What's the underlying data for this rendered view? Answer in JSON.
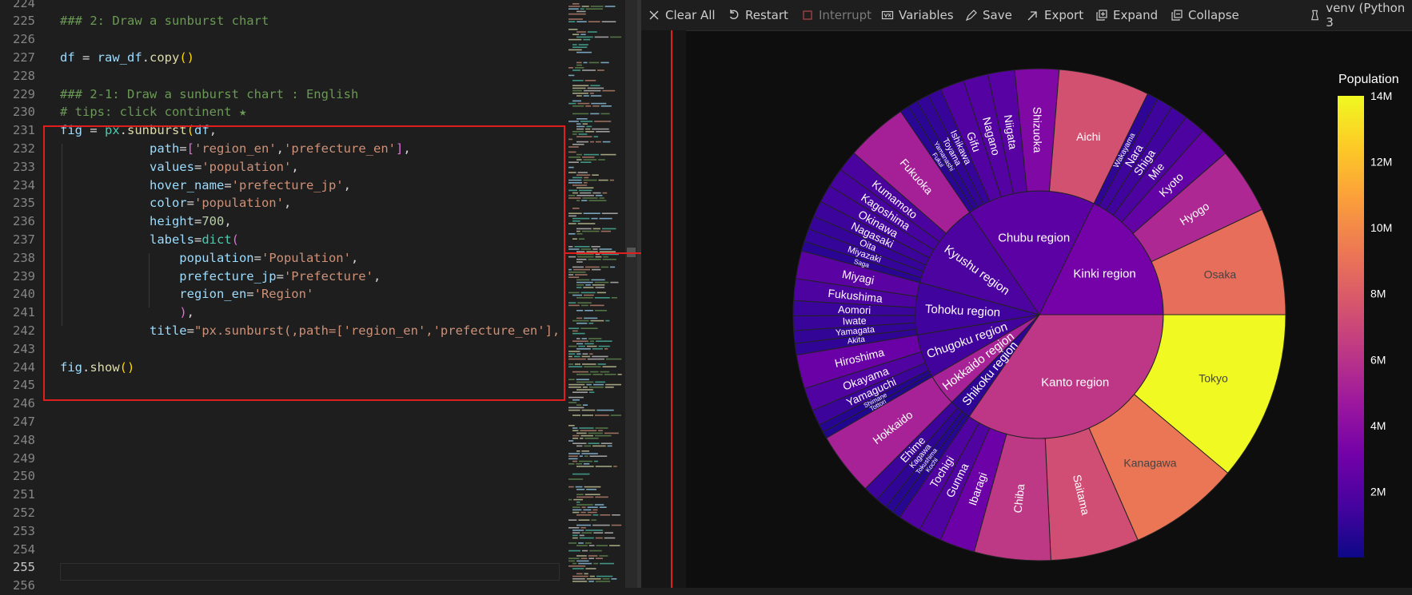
{
  "editor": {
    "current_line": 255,
    "lines": [
      {
        "n": 224,
        "tokens": []
      },
      {
        "n": 225,
        "tokens": [
          {
            "t": "### 2: Draw a sunburst chart",
            "c": "com"
          }
        ]
      },
      {
        "n": 226,
        "tokens": []
      },
      {
        "n": 227,
        "tokens": [
          {
            "t": "df",
            "c": "var"
          },
          {
            "t": " = ",
            "c": "op"
          },
          {
            "t": "raw_df",
            "c": "var"
          },
          {
            "t": ".",
            "c": "op"
          },
          {
            "t": "copy",
            "c": "fn"
          },
          {
            "t": "()",
            "c": "br"
          }
        ]
      },
      {
        "n": 228,
        "tokens": []
      },
      {
        "n": 229,
        "tokens": [
          {
            "t": "### 2-1: Draw a sunburst chart : English",
            "c": "com"
          }
        ]
      },
      {
        "n": 230,
        "tokens": [
          {
            "t": "# tips: click continent ★",
            "c": "com"
          }
        ]
      },
      {
        "n": 231,
        "tokens": [
          {
            "t": "fig",
            "c": "var"
          },
          {
            "t": " = ",
            "c": "op"
          },
          {
            "t": "px",
            "c": "cls"
          },
          {
            "t": ".",
            "c": "op"
          },
          {
            "t": "sunburst",
            "c": "fn"
          },
          {
            "t": "(",
            "c": "br"
          },
          {
            "t": "df",
            "c": "var"
          },
          {
            "t": ",",
            "c": "op"
          }
        ]
      },
      {
        "n": 232,
        "tokens": [
          {
            "t": "            path",
            "c": "var"
          },
          {
            "t": "=",
            "c": "op"
          },
          {
            "t": "[",
            "c": "br2"
          },
          {
            "t": "'region_en'",
            "c": "str"
          },
          {
            "t": ",",
            "c": "op"
          },
          {
            "t": "'prefecture_en'",
            "c": "str"
          },
          {
            "t": "]",
            "c": "br2"
          },
          {
            "t": ",",
            "c": "op"
          }
        ]
      },
      {
        "n": 233,
        "tokens": [
          {
            "t": "            values",
            "c": "var"
          },
          {
            "t": "=",
            "c": "op"
          },
          {
            "t": "'population'",
            "c": "str"
          },
          {
            "t": ",",
            "c": "op"
          }
        ]
      },
      {
        "n": 234,
        "tokens": [
          {
            "t": "            hover_name",
            "c": "var"
          },
          {
            "t": "=",
            "c": "op"
          },
          {
            "t": "'prefecture_jp'",
            "c": "str"
          },
          {
            "t": ",",
            "c": "op"
          }
        ]
      },
      {
        "n": 235,
        "tokens": [
          {
            "t": "            color",
            "c": "var"
          },
          {
            "t": "=",
            "c": "op"
          },
          {
            "t": "'population'",
            "c": "str"
          },
          {
            "t": ",",
            "c": "op"
          }
        ]
      },
      {
        "n": 236,
        "tokens": [
          {
            "t": "            height",
            "c": "var"
          },
          {
            "t": "=",
            "c": "op"
          },
          {
            "t": "700",
            "c": "num"
          },
          {
            "t": ",",
            "c": "op"
          }
        ]
      },
      {
        "n": 237,
        "tokens": [
          {
            "t": "            labels",
            "c": "var"
          },
          {
            "t": "=",
            "c": "op"
          },
          {
            "t": "dict",
            "c": "cls"
          },
          {
            "t": "(",
            "c": "br2"
          }
        ]
      },
      {
        "n": 238,
        "tokens": [
          {
            "t": "                population",
            "c": "var"
          },
          {
            "t": "=",
            "c": "op"
          },
          {
            "t": "'Population'",
            "c": "str"
          },
          {
            "t": ",",
            "c": "op"
          }
        ]
      },
      {
        "n": 239,
        "tokens": [
          {
            "t": "                prefecture_jp",
            "c": "var"
          },
          {
            "t": "=",
            "c": "op"
          },
          {
            "t": "'Prefecture'",
            "c": "str"
          },
          {
            "t": ",",
            "c": "op"
          }
        ]
      },
      {
        "n": 240,
        "tokens": [
          {
            "t": "                region_en",
            "c": "var"
          },
          {
            "t": "=",
            "c": "op"
          },
          {
            "t": "'Region'",
            "c": "str"
          }
        ]
      },
      {
        "n": 241,
        "tokens": [
          {
            "t": "                ",
            "c": "op"
          },
          {
            "t": ")",
            "c": "br2"
          },
          {
            "t": ",",
            "c": "op"
          }
        ]
      },
      {
        "n": 242,
        "tokens": [
          {
            "t": "            title",
            "c": "var"
          },
          {
            "t": "=",
            "c": "op"
          },
          {
            "t": "\"px.sunburst(,path=['region_en','prefecture_en'],",
            "c": "str"
          }
        ]
      },
      {
        "n": 243,
        "tokens": []
      },
      {
        "n": 244,
        "tokens": [
          {
            "t": "fig",
            "c": "var"
          },
          {
            "t": ".",
            "c": "op"
          },
          {
            "t": "show",
            "c": "fn"
          },
          {
            "t": "()",
            "c": "br"
          }
        ]
      },
      {
        "n": 245,
        "tokens": []
      },
      {
        "n": 246,
        "tokens": []
      },
      {
        "n": 247,
        "tokens": []
      },
      {
        "n": 248,
        "tokens": []
      },
      {
        "n": 249,
        "tokens": []
      },
      {
        "n": 250,
        "tokens": []
      },
      {
        "n": 251,
        "tokens": []
      },
      {
        "n": 252,
        "tokens": []
      },
      {
        "n": 253,
        "tokens": []
      },
      {
        "n": 254,
        "tokens": []
      },
      {
        "n": 255,
        "tokens": []
      },
      {
        "n": 256,
        "tokens": []
      }
    ]
  },
  "toolbar": {
    "clear_all": "Clear All",
    "restart": "Restart",
    "interrupt": "Interrupt",
    "variables": "Variables",
    "save": "Save",
    "export": "Export",
    "expand": "Expand",
    "collapse": "Collapse",
    "kernel": "venv (Python 3"
  },
  "colors": {
    "highlight_box": "#e01e1e",
    "colorscale": [
      "#0d0887",
      "#46039f",
      "#7201a8",
      "#9c179e",
      "#bd3786",
      "#d8576b",
      "#ed7953",
      "#fb9f3a",
      "#fdca26",
      "#f0f921"
    ]
  },
  "chart_data": {
    "type": "sunburst",
    "colorbar": {
      "title": "Population",
      "range": [
        0,
        14000000
      ],
      "tick_values": [
        2000000,
        4000000,
        6000000,
        8000000,
        10000000,
        12000000,
        14000000
      ],
      "tick_labels": [
        "2M",
        "4M",
        "6M",
        "8M",
        "10M",
        "12M",
        "14M"
      ]
    },
    "regions": [
      {
        "name": "Kanto region",
        "label": "Kanto region",
        "prefectures": [
          {
            "name": "Tokyo",
            "value": 14000000
          },
          {
            "name": "Kanagawa",
            "value": 9200000
          },
          {
            "name": "Saitama",
            "value": 7300000
          },
          {
            "name": "Chiba",
            "value": 6300000
          },
          {
            "name": "Ibaragi",
            "value": 2900000
          },
          {
            "name": "Gunma",
            "value": 1900000
          },
          {
            "name": "Tochigi",
            "value": 1900000
          }
        ]
      },
      {
        "name": "Shikoku region",
        "label": "Shikoku region",
        "prefectures": [
          {
            "name": "Kochi",
            "value": 700000
          },
          {
            "name": "Tokushima",
            "value": 700000
          },
          {
            "name": "Kagawa",
            "value": 950000
          },
          {
            "name": "Ehime",
            "value": 1300000
          }
        ]
      },
      {
        "name": "Hokkaido region",
        "label": "Hokkaido region",
        "prefectures": [
          {
            "name": "Hokkaido",
            "value": 5200000
          }
        ]
      },
      {
        "name": "Chugoku region",
        "label": "Chugoku region",
        "prefectures": [
          {
            "name": "Tottori",
            "value": 550000
          },
          {
            "name": "Shimane",
            "value": 670000
          },
          {
            "name": "Yamaguchi",
            "value": 1300000
          },
          {
            "name": "Okayama",
            "value": 1900000
          },
          {
            "name": "Hiroshima",
            "value": 2800000
          }
        ]
      },
      {
        "name": "Tohoku region",
        "label": "Tohoku region",
        "prefectures": [
          {
            "name": "Akita",
            "value": 950000
          },
          {
            "name": "Yamagata",
            "value": 1050000
          },
          {
            "name": "Iwate",
            "value": 1200000
          },
          {
            "name": "Aomori",
            "value": 1250000
          },
          {
            "name": "Fukushima",
            "value": 1800000
          },
          {
            "name": "Miyagi",
            "value": 2300000
          }
        ]
      },
      {
        "name": "Kyushu region",
        "label": "Kyushu region",
        "prefectures": [
          {
            "name": "Saga",
            "value": 800000
          },
          {
            "name": "Miyazaki",
            "value": 1070000
          },
          {
            "name": "Oita",
            "value": 1120000
          },
          {
            "name": "Nagasaki",
            "value": 1310000
          },
          {
            "name": "Okinawa",
            "value": 1470000
          },
          {
            "name": "Kagoshima",
            "value": 1590000
          },
          {
            "name": "Kumamoto",
            "value": 1740000
          },
          {
            "name": "Fukuoka",
            "value": 5100000
          }
        ]
      },
      {
        "name": "Chubu region",
        "label": "Chubu region",
        "prefectures": [
          {
            "name": "Fukui",
            "value": 760000
          },
          {
            "name": "Yamanashi",
            "value": 810000
          },
          {
            "name": "Toyama",
            "value": 1030000
          },
          {
            "name": "Ishikawa",
            "value": 1130000
          },
          {
            "name": "Gifu",
            "value": 1980000
          },
          {
            "name": "Nagano",
            "value": 2050000
          },
          {
            "name": "Niigata",
            "value": 2200000
          },
          {
            "name": "Shizuoka",
            "value": 3630000
          },
          {
            "name": "Aichi",
            "value": 7500000
          }
        ]
      },
      {
        "name": "Kinki region",
        "label": "Kinki region",
        "prefectures": [
          {
            "name": "Wakayama",
            "value": 920000
          },
          {
            "name": "Nara",
            "value": 1330000
          },
          {
            "name": "Shiga",
            "value": 1410000
          },
          {
            "name": "Mie",
            "value": 1770000
          },
          {
            "name": "Kyoto",
            "value": 2580000
          },
          {
            "name": "Hyogo",
            "value": 5470000
          },
          {
            "name": "Osaka",
            "value": 8840000
          }
        ]
      }
    ]
  }
}
